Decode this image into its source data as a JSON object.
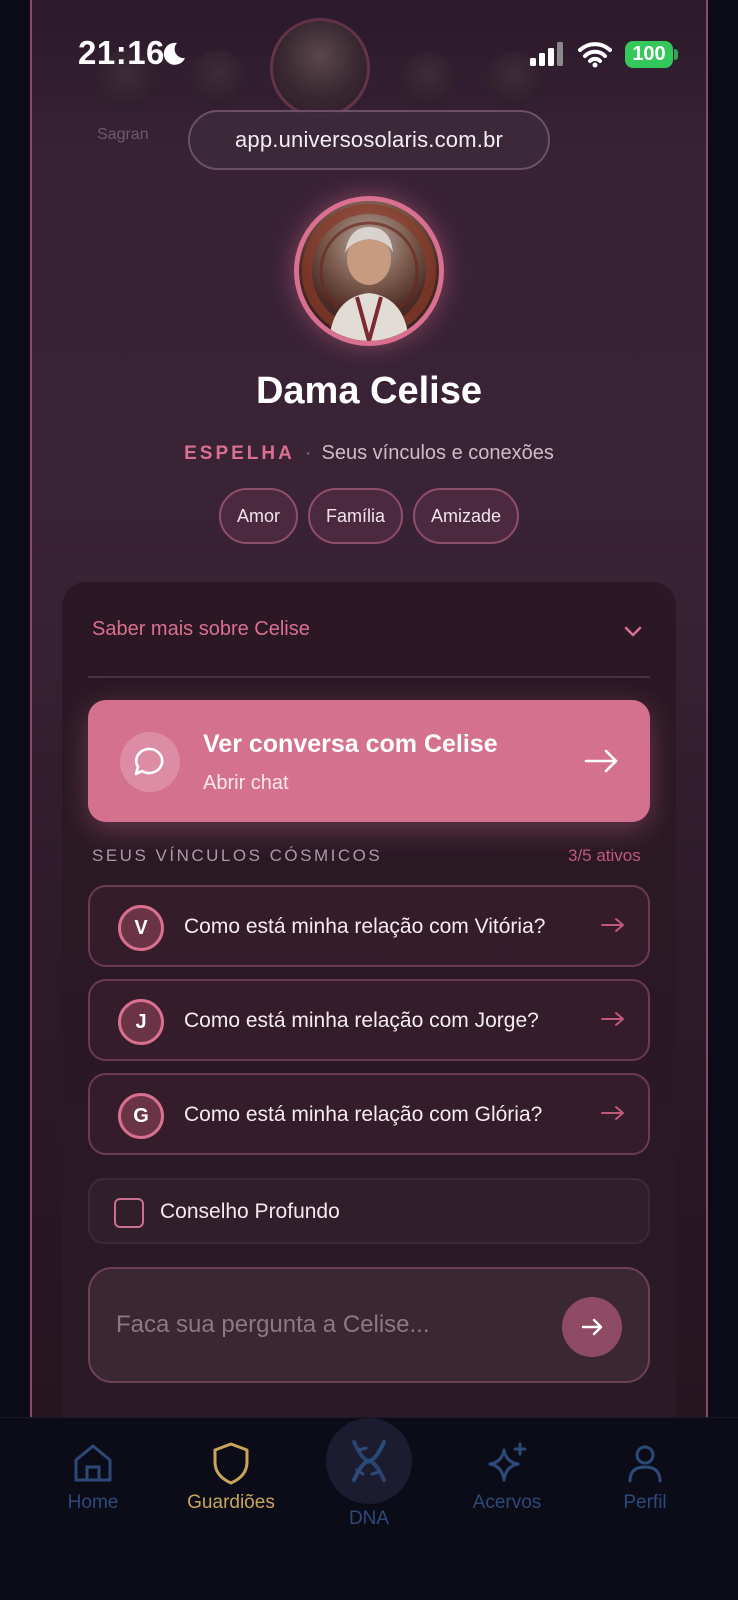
{
  "status_bar": {
    "time": "21:16",
    "battery": "100"
  },
  "browser": {
    "url": "app.universosolaris.com.br"
  },
  "carousel": {
    "ghost_label": "Sagran"
  },
  "guardian": {
    "name": "Dama Celise",
    "category": "ESPELHA",
    "separator": "·",
    "description": "Seus vínculos e conexões",
    "tags": [
      "Amor",
      "Família",
      "Amizade"
    ]
  },
  "card": {
    "more_label": "Saber mais sobre Celise",
    "cta": {
      "title": "Ver conversa com Celise",
      "subtitle": "Abrir chat"
    },
    "section_label": "SEUS VÍNCULOS CÓSMICOS",
    "section_count": "3/5 ativos",
    "links": [
      {
        "initial": "V",
        "question": "Como está minha relação com Vitória?"
      },
      {
        "initial": "J",
        "question": "Como está minha relação com Jorge?"
      },
      {
        "initial": "G",
        "question": "Como está minha relação com Glória?"
      }
    ],
    "conselho_label": "Conselho Profundo",
    "ask_placeholder": "Faca sua pergunta a Celise..."
  },
  "nav": {
    "items": [
      {
        "label": "Home",
        "icon": "home-icon",
        "color": "#2c4a78"
      },
      {
        "label": "Guardiões",
        "icon": "shield-icon",
        "color": "#c9a55a"
      },
      {
        "label": "DNA",
        "icon": "dna-icon",
        "color": "#2c4a78"
      },
      {
        "label": "Acervos",
        "icon": "sparkle-icon",
        "color": "#2c4a78"
      },
      {
        "label": "Perfil",
        "icon": "user-icon",
        "color": "#2c4a78"
      }
    ]
  },
  "colors": {
    "accent": "#d4718f",
    "background": "#0b0b17",
    "active_nav": "#c9a55a"
  }
}
